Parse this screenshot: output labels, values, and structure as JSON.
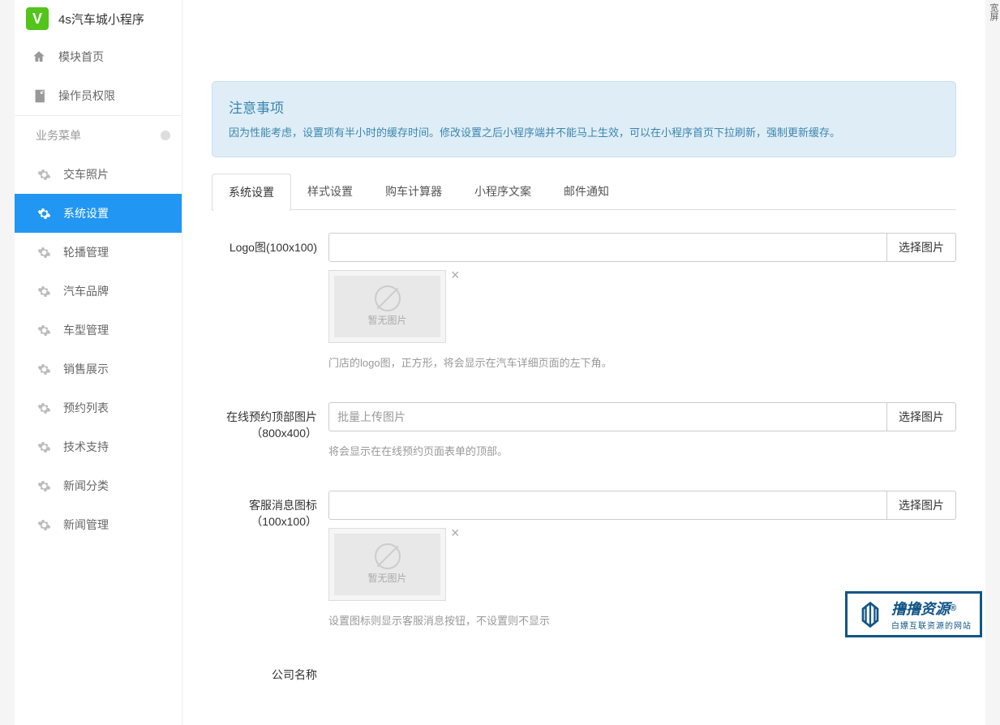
{
  "header": {
    "logo_letter": "V",
    "app_title": "4s汽车城小程序"
  },
  "sidebar": {
    "primary": [
      {
        "icon": "home",
        "label": "模块首页"
      },
      {
        "icon": "doc",
        "label": "操作员权限"
      }
    ],
    "section_label": "业务菜单",
    "items": [
      {
        "icon": "gear",
        "label": "交车照片",
        "active": false
      },
      {
        "icon": "gear",
        "label": "系统设置",
        "active": true
      },
      {
        "icon": "gear",
        "label": "轮播管理",
        "active": false
      },
      {
        "icon": "gear",
        "label": "汽车品牌",
        "active": false
      },
      {
        "icon": "gear",
        "label": "车型管理",
        "active": false
      },
      {
        "icon": "gear",
        "label": "销售展示",
        "active": false
      },
      {
        "icon": "gear",
        "label": "预约列表",
        "active": false
      },
      {
        "icon": "gear",
        "label": "技术支持",
        "active": false
      },
      {
        "icon": "gear",
        "label": "新闻分类",
        "active": false
      },
      {
        "icon": "gear",
        "label": "新闻管理",
        "active": false
      }
    ]
  },
  "alert": {
    "title": "注意事项",
    "text": "因为性能考虑，设置项有半小时的缓存时间。修改设置之后小程序端并不能马上生效，可以在小程序首页下拉刷新，强制更新缓存。"
  },
  "tabs": [
    {
      "label": "系统设置",
      "active": true
    },
    {
      "label": "样式设置",
      "active": false
    },
    {
      "label": "购车计算器",
      "active": false
    },
    {
      "label": "小程序文案",
      "active": false
    },
    {
      "label": "邮件通知",
      "active": false
    }
  ],
  "form": {
    "fields": {
      "logo": {
        "label": "Logo图(100x100)",
        "btn": "选择图片",
        "placeholder_text": "暂无图片",
        "help": "门店的logo图，正方形，将会显示在汽车详细页面的左下角。"
      },
      "booking_banner": {
        "label": "在线预约顶部图片（800x400）",
        "placeholder": "批量上传图片",
        "btn": "选择图片",
        "help": "将会显示在在线预约页面表单的顶部。"
      },
      "service_icon": {
        "label": "客服消息图标（100x100）",
        "btn": "选择图片",
        "placeholder_text": "暂无图片",
        "help": "设置图标则显示客服消息按钮，不设置则不显示"
      },
      "company_name": {
        "label": "公司名称"
      }
    }
  },
  "right_bar": "宽屏",
  "watermark": {
    "main": "撸撸资源",
    "sup": "®",
    "sub": "白嫖互联资源的网站"
  }
}
